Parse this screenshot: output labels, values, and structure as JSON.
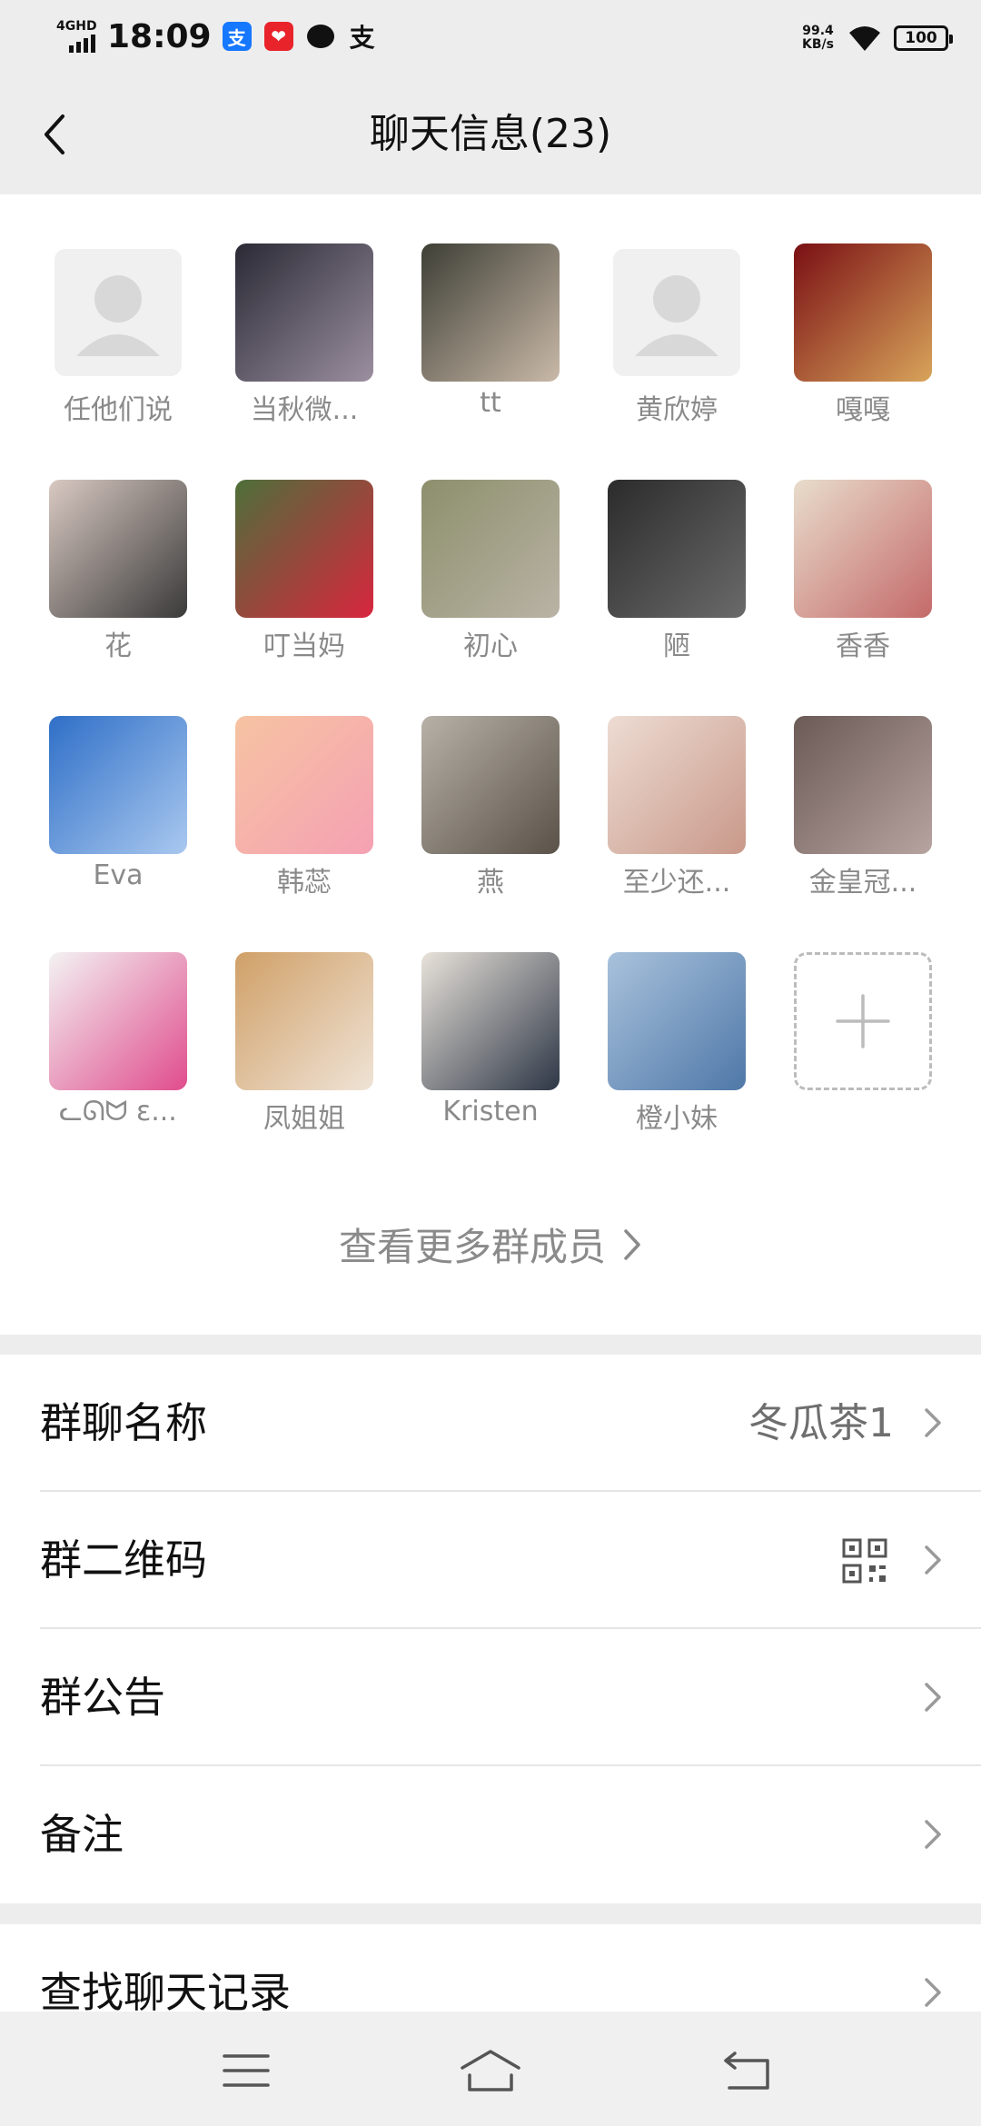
{
  "status": {
    "network": "4GHD",
    "time": "18:09",
    "app_icons": [
      "alipay-icon",
      "red-app-icon",
      "message-icon",
      "alipay-outline-icon"
    ],
    "speed_value": "99.4",
    "speed_unit": "KB/s",
    "battery": "100"
  },
  "header": {
    "title": "聊天信息(23)"
  },
  "members": [
    {
      "name": "任他们说",
      "avatar": "default",
      "colors": [
        "#f0f0f0",
        "#d8d8d8"
      ]
    },
    {
      "name": "当秋微...",
      "avatar": "photo",
      "colors": [
        "#2a2a35",
        "#9b8fa0"
      ]
    },
    {
      "name": "tt",
      "avatar": "photo",
      "colors": [
        "#3e3f36",
        "#c9b9a8"
      ]
    },
    {
      "name": "黄欣婷",
      "avatar": "default",
      "colors": [
        "#f0f0f0",
        "#d8d8d8"
      ]
    },
    {
      "name": "嘎嘎",
      "avatar": "photo",
      "colors": [
        "#7a0f14",
        "#d8a45a"
      ]
    },
    {
      "name": "花",
      "avatar": "photo",
      "colors": [
        "#d9c9c2",
        "#3a3a3a"
      ]
    },
    {
      "name": "叮当妈",
      "avatar": "photo",
      "colors": [
        "#4d6f3a",
        "#d8263e"
      ]
    },
    {
      "name": "初心",
      "avatar": "photo",
      "colors": [
        "#8d8f6c",
        "#b9b3a5"
      ]
    },
    {
      "name": "陋",
      "avatar": "photo",
      "colors": [
        "#2b2b2b",
        "#6a6a6a"
      ]
    },
    {
      "name": "香香",
      "avatar": "photo",
      "colors": [
        "#e8ddcc",
        "#c46a6a"
      ]
    },
    {
      "name": "Eva",
      "avatar": "photo",
      "colors": [
        "#2f6fc7",
        "#a9c8ef"
      ]
    },
    {
      "name": "韩蕊",
      "avatar": "photo",
      "colors": [
        "#f6c3a2",
        "#f5a1b3"
      ]
    },
    {
      "name": "燕",
      "avatar": "photo",
      "colors": [
        "#b7b1a8",
        "#5a5248"
      ]
    },
    {
      "name": "至少还...",
      "avatar": "photo",
      "colors": [
        "#eddcd3",
        "#c9998a"
      ]
    },
    {
      "name": "金皇冠...",
      "avatar": "photo",
      "colors": [
        "#6b5a56",
        "#b7a39f"
      ]
    },
    {
      "name": "ᓚᘏᗢ ε...",
      "avatar": "photo",
      "colors": [
        "#f3f3f3",
        "#e04c8d"
      ]
    },
    {
      "name": "凤姐姐",
      "avatar": "photo",
      "colors": [
        "#d0a067",
        "#efe3d6"
      ]
    },
    {
      "name": "Kristen",
      "avatar": "photo",
      "colors": [
        "#e8e2da",
        "#2e3746"
      ]
    },
    {
      "name": "橙小妹",
      "avatar": "photo",
      "colors": [
        "#a9c2dc",
        "#4f78a8"
      ]
    }
  ],
  "add_member_icon": "plus-icon",
  "more_members_label": "查看更多群成员",
  "settings_group1": [
    {
      "label": "群聊名称",
      "value": "冬瓜茶1",
      "type": "value"
    },
    {
      "label": "群二维码",
      "value": "",
      "type": "qr"
    },
    {
      "label": "群公告",
      "value": "",
      "type": "plain"
    },
    {
      "label": "备注",
      "value": "",
      "type": "plain"
    }
  ],
  "settings_group2": [
    {
      "label": "查找聊天记录",
      "value": "",
      "type": "plain"
    }
  ],
  "nav": {
    "menu_icon": "menu-icon",
    "home_icon": "home-icon",
    "back_icon": "return-icon"
  }
}
